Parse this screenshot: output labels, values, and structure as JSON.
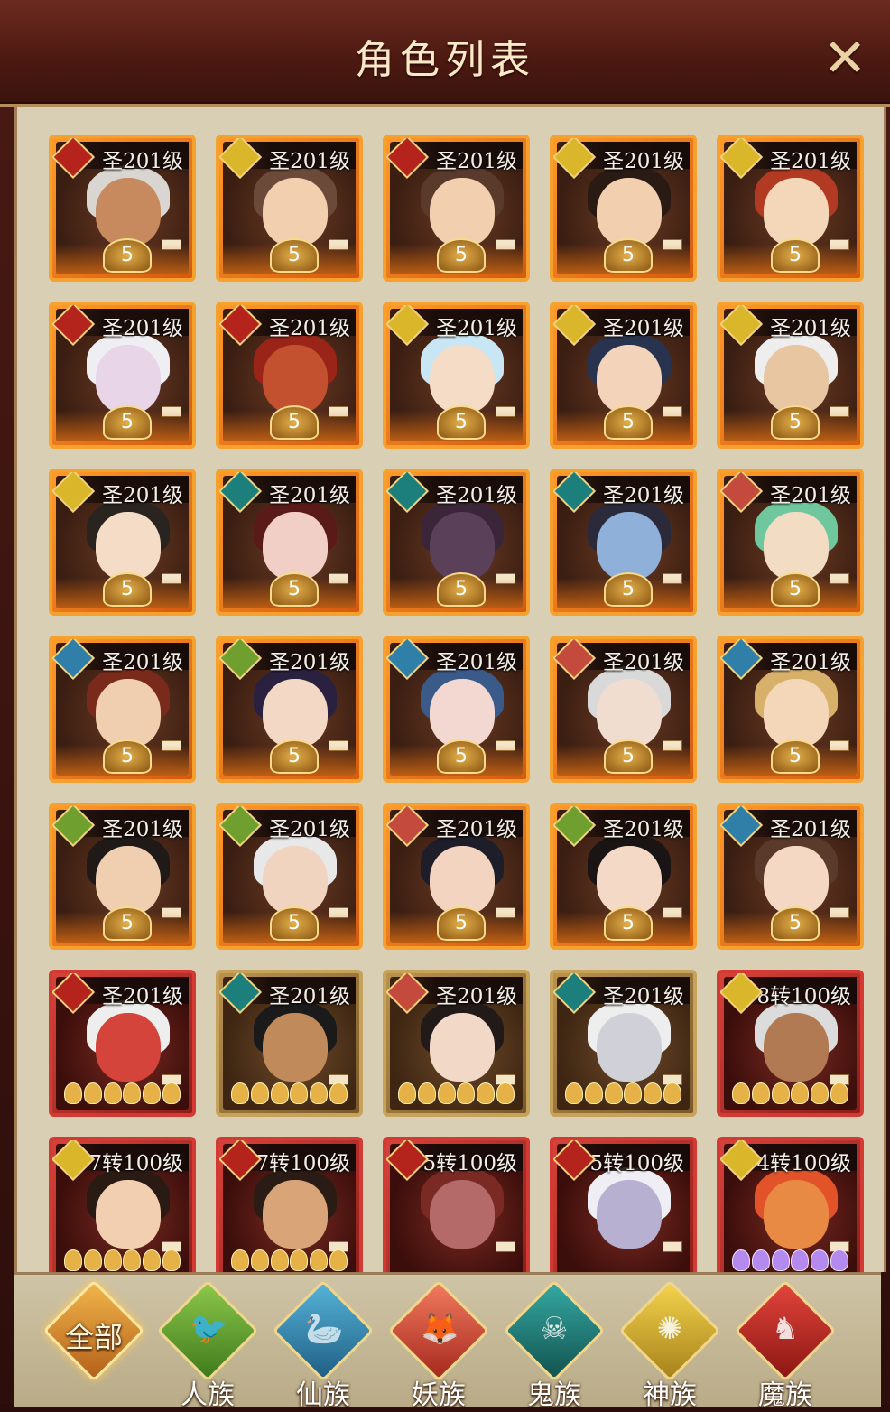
{
  "header": {
    "title": "角色列表",
    "close_glyph": "✕"
  },
  "cards": [
    {
      "level": "圣201级",
      "race": "mo",
      "frame": "orange",
      "bottom": "5",
      "skin": "#c68a5e",
      "hair": "#d9d6d2"
    },
    {
      "level": "圣201级",
      "race": "shen",
      "frame": "orange",
      "bottom": "5",
      "skin": "#f2cfae",
      "hair": "#6b4a3a"
    },
    {
      "level": "圣201级",
      "race": "mo",
      "frame": "orange",
      "bottom": "5",
      "skin": "#f2cfae",
      "hair": "#5a3a2a"
    },
    {
      "level": "圣201级",
      "race": "shen",
      "frame": "orange",
      "bottom": "5",
      "skin": "#f2cfae",
      "hair": "#2a1a14"
    },
    {
      "level": "圣201级",
      "race": "shen",
      "frame": "orange",
      "bottom": "5",
      "skin": "#f4d6b8",
      "hair": "#b23a22"
    },
    {
      "level": "圣201级",
      "race": "mo",
      "frame": "orange",
      "bottom": "5",
      "skin": "#e8d6e8",
      "hair": "#eeeef3"
    },
    {
      "level": "圣201级",
      "race": "mo",
      "frame": "orange",
      "bottom": "5",
      "skin": "#c3502f",
      "hair": "#9b2418"
    },
    {
      "level": "圣201级",
      "race": "shen",
      "frame": "orange",
      "bottom": "5",
      "skin": "#f5dcc6",
      "hair": "#c9e6f4"
    },
    {
      "level": "圣201级",
      "race": "shen",
      "frame": "orange",
      "bottom": "5",
      "skin": "#f3d3b9",
      "hair": "#27334f"
    },
    {
      "level": "圣201级",
      "race": "shen",
      "frame": "orange",
      "bottom": "5",
      "skin": "#e9c6a2",
      "hair": "#eeeeee"
    },
    {
      "level": "圣201级",
      "race": "shen",
      "frame": "orange",
      "bottom": "5",
      "skin": "#f4dcc6",
      "hair": "#2a2420"
    },
    {
      "level": "圣201级",
      "race": "gui",
      "frame": "orange",
      "bottom": "5",
      "skin": "#f2cfc6",
      "hair": "#5a1a18"
    },
    {
      "level": "圣201级",
      "race": "gui",
      "frame": "orange",
      "bottom": "5",
      "skin": "#5a4058",
      "hair": "#3a2638"
    },
    {
      "level": "圣201级",
      "race": "gui",
      "frame": "orange",
      "bottom": "5",
      "skin": "#8fb0d8",
      "hair": "#2a2a3a"
    },
    {
      "level": "圣201级",
      "race": "yao",
      "frame": "orange",
      "bottom": "5",
      "skin": "#f3dcc4",
      "hair": "#6fc79e"
    },
    {
      "level": "圣201级",
      "race": "xian",
      "frame": "orange",
      "bottom": "5",
      "skin": "#f0cfb0",
      "hair": "#7a2a1a"
    },
    {
      "level": "圣201级",
      "race": "ren",
      "frame": "orange",
      "bottom": "5",
      "skin": "#f3d8c6",
      "hair": "#2a2040"
    },
    {
      "level": "圣201级",
      "race": "xian",
      "frame": "orange",
      "bottom": "5",
      "skin": "#f2d8d0",
      "hair": "#3a5a8a"
    },
    {
      "level": "圣201级",
      "race": "yao",
      "frame": "orange",
      "bottom": "5",
      "skin": "#f0ddd0",
      "hair": "#d9d9d9"
    },
    {
      "level": "圣201级",
      "race": "xian",
      "frame": "orange",
      "bottom": "5",
      "skin": "#f4d6b8",
      "hair": "#d7b06a"
    },
    {
      "level": "圣201级",
      "race": "ren",
      "frame": "orange",
      "bottom": "5",
      "skin": "#f0cfb0",
      "hair": "#1f1a18"
    },
    {
      "level": "圣201级",
      "race": "ren",
      "frame": "orange",
      "bottom": "5",
      "skin": "#f0d4c0",
      "hair": "#e8e8e8"
    },
    {
      "level": "圣201级",
      "race": "yao",
      "frame": "orange",
      "bottom": "5",
      "skin": "#f3d4c0",
      "hair": "#1e1e2a"
    },
    {
      "level": "圣201级",
      "race": "ren",
      "frame": "orange",
      "bottom": "5",
      "skin": "#f4dac6",
      "hair": "#1a1414"
    },
    {
      "level": "圣201级",
      "race": "xian",
      "frame": "orange",
      "bottom": "5",
      "skin": "#f4d8c4",
      "hair": "#5a3a2a"
    },
    {
      "level": "圣201级",
      "race": "mo",
      "frame": "red",
      "bottom": "pips",
      "skin": "#d4443a",
      "hair": "#eeeeee"
    },
    {
      "level": "圣201级",
      "race": "gui",
      "frame": "gold",
      "bottom": "pips",
      "skin": "#c08a5a",
      "hair": "#1a1a1a"
    },
    {
      "level": "圣201级",
      "race": "yao",
      "frame": "gold",
      "bottom": "pips",
      "skin": "#f2d8c6",
      "hair": "#221a18"
    },
    {
      "level": "圣201级",
      "race": "gui",
      "frame": "gold",
      "bottom": "pips",
      "skin": "#d0d0d8",
      "hair": "#eeeeee"
    },
    {
      "level": "8转100级",
      "race": "shen",
      "frame": "red",
      "bottom": "pips",
      "skin": "#b27a52",
      "hair": "#dcdcdc"
    },
    {
      "level": "7转100级",
      "race": "shen",
      "frame": "red",
      "bottom": "pips",
      "skin": "#f2cfb0",
      "hair": "#2a1a14"
    },
    {
      "level": "7转100级",
      "race": "mo",
      "frame": "red",
      "bottom": "pips",
      "skin": "#d8a478",
      "hair": "#2a1c14"
    },
    {
      "level": "5转100级",
      "race": "mo",
      "frame": "red",
      "bottom": "none",
      "skin": "#b56a6a",
      "hair": "#7a2a22"
    },
    {
      "level": "5转100级",
      "race": "mo",
      "frame": "red",
      "bottom": "none",
      "skin": "#b8b0d0",
      "hair": "#eeeef4"
    },
    {
      "level": "4转100级",
      "race": "shen",
      "frame": "red",
      "bottom": "pips-purple",
      "skin": "#e88a44",
      "hair": "#e2532a"
    }
  ],
  "tabs": [
    {
      "key": "all",
      "label": "全部",
      "glyph": "",
      "icon": "all-icon"
    },
    {
      "key": "ren",
      "label": "人族",
      "glyph": "🐦",
      "icon": "swallow-icon"
    },
    {
      "key": "xian",
      "label": "仙族",
      "glyph": "🦢",
      "icon": "crane-icon"
    },
    {
      "key": "yao",
      "label": "妖族",
      "glyph": "🦊",
      "icon": "fox-icon"
    },
    {
      "key": "gui",
      "label": "鬼族",
      "glyph": "☠",
      "icon": "ghost-icon"
    },
    {
      "key": "shen",
      "label": "神族",
      "glyph": "✺",
      "icon": "sun-emblem-icon"
    },
    {
      "key": "mo",
      "label": "魔族",
      "glyph": "♞",
      "icon": "demon-mask-icon"
    }
  ]
}
